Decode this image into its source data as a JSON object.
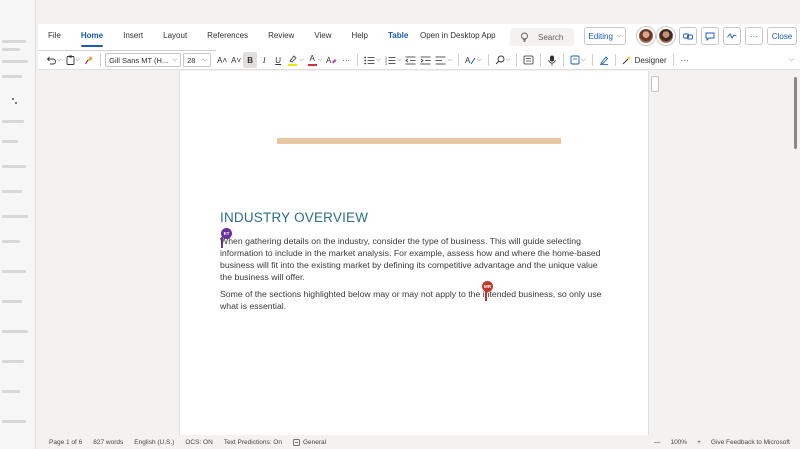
{
  "ribbon": {
    "tabs": [
      {
        "label": "File"
      },
      {
        "label": "Home"
      },
      {
        "label": "Insert"
      },
      {
        "label": "Layout"
      },
      {
        "label": "References"
      },
      {
        "label": "Review"
      },
      {
        "label": "View"
      },
      {
        "label": "Help"
      },
      {
        "label": "Table"
      }
    ],
    "active_tab": "Home",
    "open_desktop_label": "Open in Desktop App",
    "search_placeholder": "Search",
    "editing_label": "Editing",
    "close_label": "Close",
    "more_label": "···"
  },
  "toolbar": {
    "font_name": "Gill Sans MT (H...",
    "font_size": "28",
    "grow_label": "A˄",
    "shrink_label": "A˅",
    "bold_label": "B",
    "italic_label": "I",
    "underline_label": "U",
    "font_color_label": "A",
    "more_label": "···",
    "designer_label": "Designer",
    "highlight_color": "#f2e600",
    "font_color": "#d13438"
  },
  "document": {
    "heading": "INDUSTRY OVERVIEW",
    "paragraph1": "When gathering details on the industry, consider the type of business. This will guide selecting information to include in the market analysis. For example, assess how and where the home-based business will fit into the existing market by defining its competitive advantage and the unique value the business will offer.",
    "paragraph2": "Some of the sections highlighted below may or may not apply to the intended business, so only use what is essential.",
    "cursor1_initials": "ET",
    "cursor2_initials": "MR",
    "heading_color": "#2b6e8f",
    "accent_bar_color": "#e9c7a4"
  },
  "status": {
    "page": "Page 1 of 6",
    "words": "827 words",
    "language": "English (U.S.)",
    "ocs": "OCS: ON",
    "predictions": "Text Predictions: On",
    "sensitivity": "General",
    "zoom_minus": "—",
    "zoom": "100%",
    "zoom_plus": "+",
    "feedback": "Give Feedback to Microsoft"
  }
}
